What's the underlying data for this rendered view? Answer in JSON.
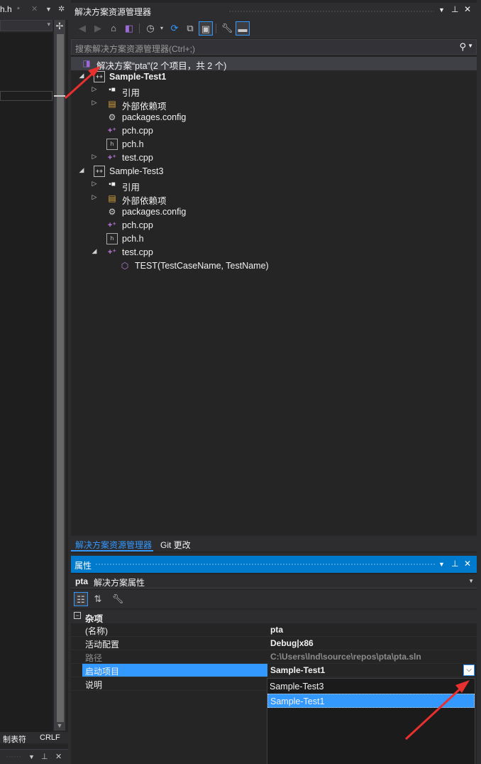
{
  "editor": {
    "tab_label": "h.h",
    "status_tab": "制表符",
    "status_eol": "CRLF"
  },
  "solution_explorer": {
    "title": "解决方案资源管理器",
    "search_placeholder": "搜索解决方案资源管理器(Ctrl+;)",
    "solution_label": "解决方案“pta”(2 个项目，共 2 个)",
    "tree": [
      {
        "label": "Sample-Test1",
        "icon": "project-icon",
        "bold": true
      },
      {
        "label": "引用",
        "icon": "references-icon"
      },
      {
        "label": "外部依赖项",
        "icon": "external-deps-icon"
      },
      {
        "label": "packages.config",
        "icon": "config-file-icon"
      },
      {
        "label": "pch.cpp",
        "icon": "cpp-file-icon"
      },
      {
        "label": "pch.h",
        "icon": "header-file-icon"
      },
      {
        "label": "test.cpp",
        "icon": "cpp-file-icon"
      },
      {
        "label": "Sample-Test3",
        "icon": "project-icon"
      },
      {
        "label": "引用",
        "icon": "references-icon"
      },
      {
        "label": "外部依赖项",
        "icon": "external-deps-icon"
      },
      {
        "label": "packages.config",
        "icon": "config-file-icon"
      },
      {
        "label": "pch.cpp",
        "icon": "cpp-file-icon"
      },
      {
        "label": "pch.h",
        "icon": "header-file-icon"
      },
      {
        "label": "test.cpp",
        "icon": "cpp-file-icon"
      },
      {
        "label": "TEST(TestCaseName, TestName)",
        "icon": "function-icon"
      }
    ],
    "tabs": [
      "解决方案资源管理器",
      "Git 更改"
    ]
  },
  "properties": {
    "title": "属性",
    "object_name": "pta",
    "object_type": "解决方案属性",
    "category": "杂项",
    "rows": [
      {
        "name": "(名称)",
        "value": "pta"
      },
      {
        "name": "活动配置",
        "value": "Debug|x86"
      },
      {
        "name": "路径",
        "value": "C:\\Users\\lnd\\source\\repos\\pta\\pta.sln"
      },
      {
        "name": "启动项目",
        "value": "Sample-Test1"
      },
      {
        "name": "说明",
        "value": ""
      }
    ],
    "dropdown_options": [
      "Sample-Test3",
      "Sample-Test1"
    ]
  },
  "colors": {
    "accent": "#3399ff",
    "title_active": "#007acc",
    "annotation_arrow": "#e8302f"
  }
}
